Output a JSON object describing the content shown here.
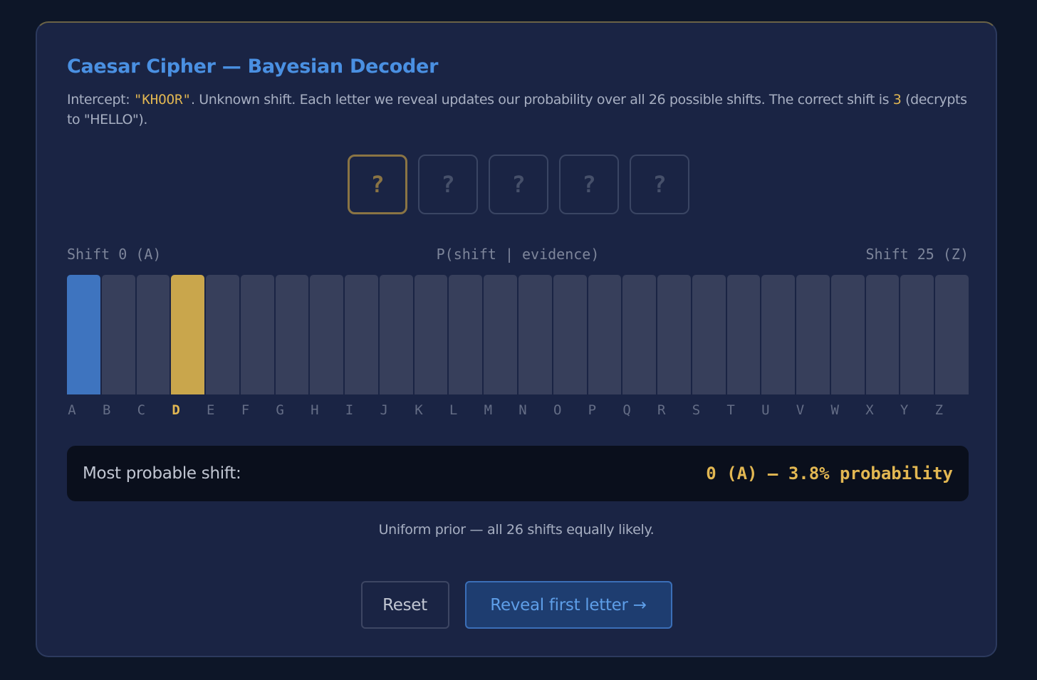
{
  "header": {
    "title": "Caesar Cipher — Bayesian Decoder",
    "desc_prefix": "Intercept: ",
    "ciphertext": "\"KHOOR\"",
    "desc_middle": ". Unknown shift. Each letter we reveal updates our probability over all 26 possible shifts. The correct shift is ",
    "correct_shift": "3",
    "desc_suffix": " (decrypts to \"HELLO\")."
  },
  "slots": [
    {
      "text": "?",
      "active": true
    },
    {
      "text": "?",
      "active": false
    },
    {
      "text": "?",
      "active": false
    },
    {
      "text": "?",
      "active": false
    },
    {
      "text": "?",
      "active": false
    }
  ],
  "chart_data": {
    "type": "bar",
    "title": "P(shift | evidence)",
    "left_label": "Shift 0 (A)",
    "right_label": "Shift 25 (Z)",
    "categories": [
      "A",
      "B",
      "C",
      "D",
      "E",
      "F",
      "G",
      "H",
      "I",
      "J",
      "K",
      "L",
      "M",
      "N",
      "O",
      "P",
      "Q",
      "R",
      "S",
      "T",
      "U",
      "V",
      "W",
      "X",
      "Y",
      "Z"
    ],
    "values": [
      0.0385,
      0.0385,
      0.0385,
      0.0385,
      0.0385,
      0.0385,
      0.0385,
      0.0385,
      0.0385,
      0.0385,
      0.0385,
      0.0385,
      0.0385,
      0.0385,
      0.0385,
      0.0385,
      0.0385,
      0.0385,
      0.0385,
      0.0385,
      0.0385,
      0.0385,
      0.0385,
      0.0385,
      0.0385,
      0.0385
    ],
    "ylim": [
      0,
      0.0385
    ],
    "most_probable_index": 0,
    "correct_index": 3,
    "colors": {
      "default": "#373f5b",
      "most_probable": "#3e74bf",
      "correct": "#c9a64c"
    }
  },
  "result": {
    "label": "Most probable shift:",
    "value": "0 (A) — 3.8% probability"
  },
  "status": "Uniform prior — all 26 shifts equally likely.",
  "buttons": {
    "reset": "Reset",
    "reveal": "Reveal first letter →"
  }
}
